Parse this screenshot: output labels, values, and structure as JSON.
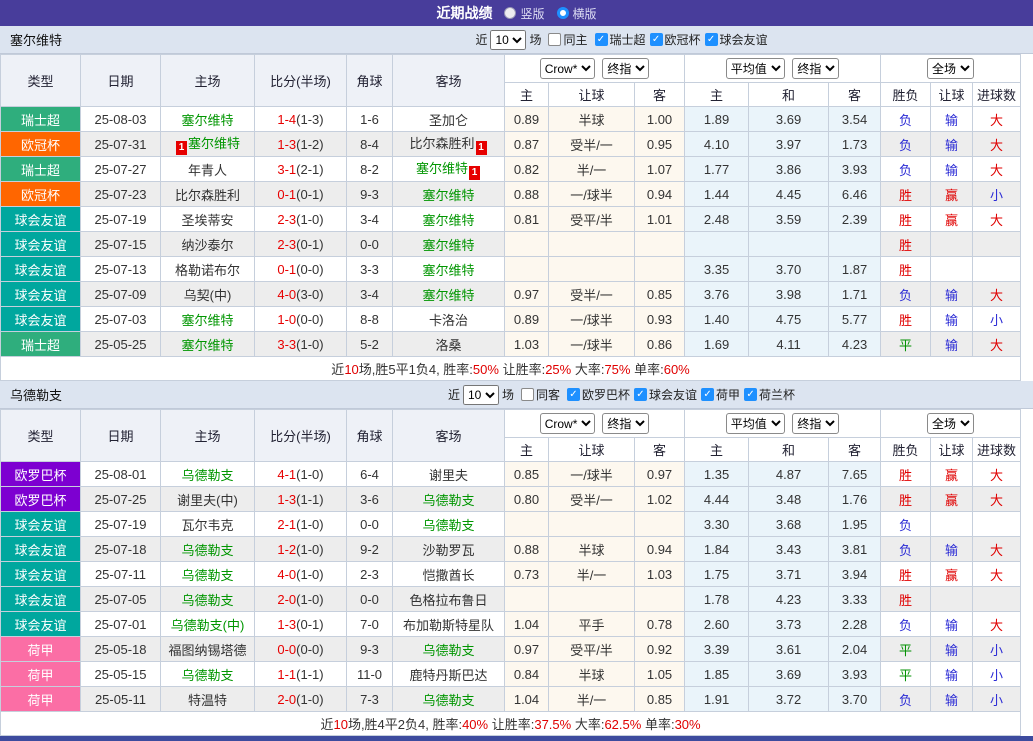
{
  "titlebar": {
    "title": "近期战绩",
    "radios": [
      {
        "label": "竖版",
        "checked": false
      },
      {
        "label": "横版",
        "checked": true
      }
    ]
  },
  "controls": {
    "near": "近",
    "count": "10",
    "games": "场",
    "crow": "Crow*",
    "final": "终指",
    "average": "平均值",
    "fulltime": "全场"
  },
  "table_header": {
    "type": "类型",
    "date": "日期",
    "home": "主场",
    "score": "比分(半场)",
    "corner": "角球",
    "away": "客场",
    "home_odds": "主",
    "handicap": "让球",
    "away_odds": "客",
    "draw_odds": "和",
    "outcome": "胜负",
    "goals": "进球数"
  },
  "theme": {
    "accent_bar": "#483d9b",
    "team_bar_bg": "#dce4f0",
    "checkbox_blue": "#1e90ff",
    "crow_col_bg": "#fdf8ef",
    "avg_col_bg": "#eaf4fa",
    "team_green": "#009600",
    "score_red": "#e80000",
    "card_red": "#e60000"
  },
  "type_colors": {
    "瑞士超": "#2fae7d",
    "欧冠杯": "#ff6600",
    "球会友谊": "#00a79e",
    "欧罗巴杯": "#7d00d1",
    "荷甲": "#fb6ea5"
  },
  "result_colors": {
    "胜": "#e00000",
    "平": "#009000",
    "负": "#2b2bd5",
    "赢": "#e00000",
    "输": "#2b2bd5",
    "大": "#e00000",
    "小": "#2b2bd5"
  },
  "sections": [
    {
      "team": "塞尔维特",
      "filters": {
        "same": {
          "label": "同主",
          "checked": false
        },
        "leagues": [
          {
            "label": "瑞士超",
            "checked": true
          },
          {
            "label": "欧冠杯",
            "checked": true
          },
          {
            "label": "球会友谊",
            "checked": true
          }
        ]
      },
      "rows": [
        {
          "league": "瑞士超",
          "date": "25-08-03",
          "home": {
            "name": "塞尔维特",
            "green": true
          },
          "score": "1-4",
          "half": "(1-3)",
          "corner": "1-6",
          "away": {
            "name": "圣加仑"
          },
          "crow": [
            "0.89",
            "半球",
            "1.00"
          ],
          "avg": [
            "1.89",
            "3.69",
            "3.54"
          ],
          "result": [
            "负",
            "输",
            "大"
          ]
        },
        {
          "league": "欧冠杯",
          "date": "25-07-31",
          "home": {
            "name": "塞尔维特",
            "green": true,
            "card": "1"
          },
          "score": "1-3",
          "half": "(1-2)",
          "corner": "8-4",
          "away": {
            "name": "比尔森胜利",
            "card": "1"
          },
          "crow": [
            "0.87",
            "受半/一",
            "0.95"
          ],
          "avg": [
            "4.10",
            "3.97",
            "1.73"
          ],
          "result": [
            "负",
            "输",
            "大"
          ]
        },
        {
          "league": "瑞士超",
          "date": "25-07-27",
          "home": {
            "name": "年青人"
          },
          "score": "3-1",
          "half": "(2-1)",
          "corner": "8-2",
          "away": {
            "name": "塞尔维特",
            "green": true,
            "card": "1"
          },
          "crow": [
            "0.82",
            "半/一",
            "1.07"
          ],
          "avg": [
            "1.77",
            "3.86",
            "3.93"
          ],
          "result": [
            "负",
            "输",
            "大"
          ]
        },
        {
          "league": "欧冠杯",
          "date": "25-07-23",
          "home": {
            "name": "比尔森胜利"
          },
          "score": "0-1",
          "half": "(0-1)",
          "corner": "9-3",
          "away": {
            "name": "塞尔维特",
            "green": true
          },
          "crow": [
            "0.88",
            "一/球半",
            "0.94"
          ],
          "avg": [
            "1.44",
            "4.45",
            "6.46"
          ],
          "result": [
            "胜",
            "赢",
            "小"
          ]
        },
        {
          "league": "球会友谊",
          "date": "25-07-19",
          "home": {
            "name": "圣埃蒂安"
          },
          "score": "2-3",
          "half": "(1-0)",
          "corner": "3-4",
          "away": {
            "name": "塞尔维特",
            "green": true
          },
          "crow": [
            "0.81",
            "受平/半",
            "1.01"
          ],
          "avg": [
            "2.48",
            "3.59",
            "2.39"
          ],
          "result": [
            "胜",
            "赢",
            "大"
          ]
        },
        {
          "league": "球会友谊",
          "date": "25-07-15",
          "home": {
            "name": "纳沙泰尔"
          },
          "score": "2-3",
          "half": "(0-1)",
          "corner": "0-0",
          "away": {
            "name": "塞尔维特",
            "green": true
          },
          "crow": [
            "",
            "",
            ""
          ],
          "avg": [
            "",
            "",
            ""
          ],
          "result": [
            "胜",
            "",
            ""
          ]
        },
        {
          "league": "球会友谊",
          "date": "25-07-13",
          "home": {
            "name": "格勒诺布尔"
          },
          "score": "0-1",
          "half": "(0-0)",
          "corner": "3-3",
          "away": {
            "name": "塞尔维特",
            "green": true
          },
          "crow": [
            "",
            "",
            ""
          ],
          "avg": [
            "3.35",
            "3.70",
            "1.87"
          ],
          "result": [
            "胜",
            "",
            ""
          ]
        },
        {
          "league": "球会友谊",
          "date": "25-07-09",
          "home": {
            "name": "乌契(中)"
          },
          "score": "4-0",
          "half": "(3-0)",
          "corner": "3-4",
          "away": {
            "name": "塞尔维特",
            "green": true
          },
          "crow": [
            "0.97",
            "受半/一",
            "0.85"
          ],
          "avg": [
            "3.76",
            "3.98",
            "1.71"
          ],
          "result": [
            "负",
            "输",
            "大"
          ]
        },
        {
          "league": "球会友谊",
          "date": "25-07-03",
          "home": {
            "name": "塞尔维特",
            "green": true
          },
          "score": "1-0",
          "half": "(0-0)",
          "corner": "8-8",
          "away": {
            "name": "卡洛治"
          },
          "crow": [
            "0.89",
            "一/球半",
            "0.93"
          ],
          "avg": [
            "1.40",
            "4.75",
            "5.77"
          ],
          "result": [
            "胜",
            "输",
            "小"
          ]
        },
        {
          "league": "瑞士超",
          "date": "25-05-25",
          "home": {
            "name": "塞尔维特",
            "green": true
          },
          "score": "3-3",
          "half": "(1-0)",
          "corner": "5-2",
          "away": {
            "name": "洛桑"
          },
          "crow": [
            "1.03",
            "一/球半",
            "0.86"
          ],
          "avg": [
            "1.69",
            "4.11",
            "4.23"
          ],
          "result": [
            "平",
            "输",
            "大"
          ]
        }
      ],
      "summary": [
        {
          "t": "近",
          "red": false
        },
        {
          "t": "10",
          "red": true
        },
        {
          "t": "场,胜5平1负4, 胜率:",
          "red": false
        },
        {
          "t": "50%",
          "red": true
        },
        {
          "t": " 让胜率:",
          "red": false
        },
        {
          "t": "25%",
          "red": true
        },
        {
          "t": " 大率:",
          "red": false
        },
        {
          "t": "75%",
          "red": true
        },
        {
          "t": " 单率:",
          "red": false
        },
        {
          "t": "60%",
          "red": true
        }
      ]
    },
    {
      "team": "乌德勒支",
      "filters": {
        "same": {
          "label": "同客",
          "checked": false
        },
        "leagues": [
          {
            "label": "欧罗巴杯",
            "checked": true
          },
          {
            "label": "球会友谊",
            "checked": true
          },
          {
            "label": "荷甲",
            "checked": true
          },
          {
            "label": "荷兰杯",
            "checked": true
          }
        ]
      },
      "rows": [
        {
          "league": "欧罗巴杯",
          "date": "25-08-01",
          "home": {
            "name": "乌德勒支",
            "green": true
          },
          "score": "4-1",
          "half": "(1-0)",
          "corner": "6-4",
          "away": {
            "name": "谢里夫"
          },
          "crow": [
            "0.85",
            "一/球半",
            "0.97"
          ],
          "avg": [
            "1.35",
            "4.87",
            "7.65"
          ],
          "result": [
            "胜",
            "赢",
            "大"
          ]
        },
        {
          "league": "欧罗巴杯",
          "date": "25-07-25",
          "home": {
            "name": "谢里夫(中)"
          },
          "score": "1-3",
          "half": "(1-1)",
          "corner": "3-6",
          "away": {
            "name": "乌德勒支",
            "green": true
          },
          "crow": [
            "0.80",
            "受半/一",
            "1.02"
          ],
          "avg": [
            "4.44",
            "3.48",
            "1.76"
          ],
          "result": [
            "胜",
            "赢",
            "大"
          ]
        },
        {
          "league": "球会友谊",
          "date": "25-07-19",
          "home": {
            "name": "瓦尔韦克"
          },
          "score": "2-1",
          "half": "(1-0)",
          "corner": "0-0",
          "away": {
            "name": "乌德勒支",
            "green": true
          },
          "crow": [
            "",
            "",
            ""
          ],
          "avg": [
            "3.30",
            "3.68",
            "1.95"
          ],
          "result": [
            "负",
            "",
            ""
          ]
        },
        {
          "league": "球会友谊",
          "date": "25-07-18",
          "home": {
            "name": "乌德勒支",
            "green": true
          },
          "score": "1-2",
          "half": "(1-0)",
          "corner": "9-2",
          "away": {
            "name": "沙勒罗瓦"
          },
          "crow": [
            "0.88",
            "半球",
            "0.94"
          ],
          "avg": [
            "1.84",
            "3.43",
            "3.81"
          ],
          "result": [
            "负",
            "输",
            "大"
          ]
        },
        {
          "league": "球会友谊",
          "date": "25-07-11",
          "home": {
            "name": "乌德勒支",
            "green": true
          },
          "score": "4-0",
          "half": "(1-0)",
          "corner": "2-3",
          "away": {
            "name": "恺撒酋长"
          },
          "crow": [
            "0.73",
            "半/一",
            "1.03"
          ],
          "avg": [
            "1.75",
            "3.71",
            "3.94"
          ],
          "result": [
            "胜",
            "赢",
            "大"
          ]
        },
        {
          "league": "球会友谊",
          "date": "25-07-05",
          "home": {
            "name": "乌德勒支",
            "green": true
          },
          "score": "2-0",
          "half": "(1-0)",
          "corner": "0-0",
          "away": {
            "name": "色格拉布鲁日"
          },
          "crow": [
            "",
            "",
            ""
          ],
          "avg": [
            "1.78",
            "4.23",
            "3.33"
          ],
          "result": [
            "胜",
            "",
            ""
          ]
        },
        {
          "league": "球会友谊",
          "date": "25-07-01",
          "home": {
            "name": "乌德勒支(中)",
            "green": true
          },
          "score": "1-3",
          "half": "(0-1)",
          "corner": "7-0",
          "away": {
            "name": "布加勒斯特星队"
          },
          "crow": [
            "1.04",
            "平手",
            "0.78"
          ],
          "avg": [
            "2.60",
            "3.73",
            "2.28"
          ],
          "result": [
            "负",
            "输",
            "大"
          ]
        },
        {
          "league": "荷甲",
          "date": "25-05-18",
          "home": {
            "name": "福图纳锡塔德"
          },
          "score": "0-0",
          "half": "(0-0)",
          "corner": "9-3",
          "away": {
            "name": "乌德勒支",
            "green": true
          },
          "crow": [
            "0.97",
            "受平/半",
            "0.92"
          ],
          "avg": [
            "3.39",
            "3.61",
            "2.04"
          ],
          "result": [
            "平",
            "输",
            "小"
          ]
        },
        {
          "league": "荷甲",
          "date": "25-05-15",
          "home": {
            "name": "乌德勒支",
            "green": true
          },
          "score": "1-1",
          "half": "(1-1)",
          "corner": "11-0",
          "away": {
            "name": "鹿特丹斯巴达"
          },
          "crow": [
            "0.84",
            "半球",
            "1.05"
          ],
          "avg": [
            "1.85",
            "3.69",
            "3.93"
          ],
          "result": [
            "平",
            "输",
            "小"
          ]
        },
        {
          "league": "荷甲",
          "date": "25-05-11",
          "home": {
            "name": "特温特"
          },
          "score": "2-0",
          "half": "(1-0)",
          "corner": "7-3",
          "away": {
            "name": "乌德勒支",
            "green": true
          },
          "crow": [
            "1.04",
            "半/一",
            "0.85"
          ],
          "avg": [
            "1.91",
            "3.72",
            "3.70"
          ],
          "result": [
            "负",
            "输",
            "小"
          ]
        }
      ],
      "summary": [
        {
          "t": "近",
          "red": false
        },
        {
          "t": "10",
          "red": true
        },
        {
          "t": "场,胜4平2负4, 胜率:",
          "red": false
        },
        {
          "t": "40%",
          "red": true
        },
        {
          "t": " 让胜率:",
          "red": false
        },
        {
          "t": "37.5%",
          "red": true
        },
        {
          "t": " 大率:",
          "red": false
        },
        {
          "t": "62.5%",
          "red": true
        },
        {
          "t": " 单率:",
          "red": false
        },
        {
          "t": "30%",
          "red": true
        }
      ]
    }
  ]
}
